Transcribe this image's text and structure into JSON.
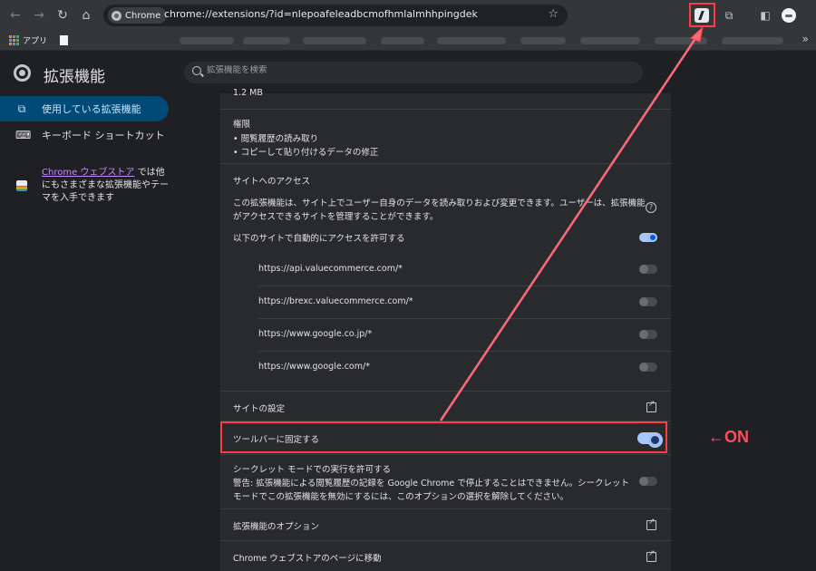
{
  "browser": {
    "chip_label": "Chrome",
    "url": "chrome://extensions/?id=nlepoafeleadbcmofhmlalmhhpingdek",
    "nav_icons": [
      "back-icon",
      "forward-icon",
      "reload-icon",
      "home-icon"
    ],
    "toolbar_icons": [
      "pinned-extension-icon",
      "extensions-puzzle-icon",
      "side-panel-icon",
      "profile-avatar"
    ]
  },
  "bookmarks": {
    "apps_label": "アプリ"
  },
  "header": {
    "title": "拡張機能",
    "search_placeholder": "拡張機能を検索"
  },
  "sidebar": {
    "items": [
      {
        "label": "使用している拡張機能",
        "icon": "puzzle-icon",
        "active": true
      },
      {
        "label": "キーボード ショートカット",
        "icon": "keyboard-icon",
        "active": false
      }
    ],
    "promo_link": "Chrome ウェブストア",
    "promo_text": " では他にもさまざまな拡張機能やテーマを入手できます"
  },
  "details": {
    "size": "1.2 MB",
    "permissions_title": "権限",
    "permissions": [
      "閲覧履歴の読み取り",
      "コピーして貼り付けるデータの修正"
    ],
    "site_access_title": "サイトへのアクセス",
    "site_access_desc_1": "この拡張機能は、サイト上でユーザー自身のデータを読み取りおよび変更できます。ユーザーは、拡張機能",
    "site_access_desc_2": "がアクセスできるサイトを管理することができます。",
    "auto_allow_label": "以下のサイトで自動的にアクセスを許可する",
    "sites": [
      "https://api.valuecommerce.com/*",
      "https://brexc.valuecommerce.com/*",
      "https://www.google.co.jp/*",
      "https://www.google.com/*"
    ],
    "site_settings": "サイトの設定",
    "pin_to_toolbar": "ツールバーに固定する",
    "incognito_title": "シークレット モードでの実行を許可する",
    "incognito_warning_1": "警告: 拡張機能による閲覧履歴の記録を Google Chrome で停止することはできません。シークレット",
    "incognito_warning_2": "モードでこの拡張機能を無効にするには、このオプションの選択を解除してください。",
    "extension_options": "拡張機能のオプション",
    "store_page": "Chrome ウェブストアのページに移動"
  },
  "annotation": {
    "on_label": "←ON",
    "color": "#ff3b45"
  },
  "colors": {
    "accent": "#a8c7fa",
    "active_nav": "#004a77"
  }
}
